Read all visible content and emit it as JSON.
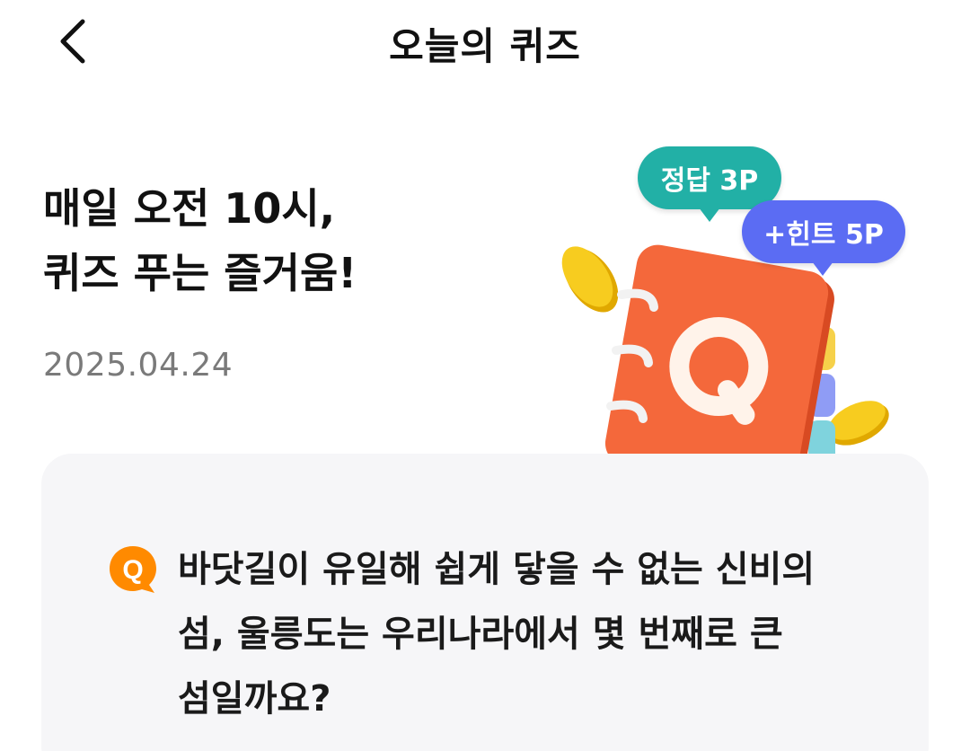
{
  "header": {
    "title": "오늘의 퀴즈",
    "back_icon": "chevron-left-icon"
  },
  "hero": {
    "title_line1": "매일 오전 10시,",
    "title_line2": "퀴즈 푸는 즐거움!",
    "date": "2025.04.24"
  },
  "illustration": {
    "answer_bubble": "정답 3P",
    "hint_bubble": "+힌트 5P",
    "notebook_letter": "Q",
    "colors": {
      "answer_bubble": "#22b0a6",
      "hint_bubble": "#5b6cf3",
      "notebook": "#f4683b",
      "coin": "#f5c518"
    }
  },
  "question": {
    "badge": "Q",
    "badge_color": "#ff8a00",
    "text": "바닷길이 유일해 쉽게 닿을 수 없는 신비의 섬, 울릉도는 우리나라에서 몇 번째로 큰 섬일까요?"
  }
}
